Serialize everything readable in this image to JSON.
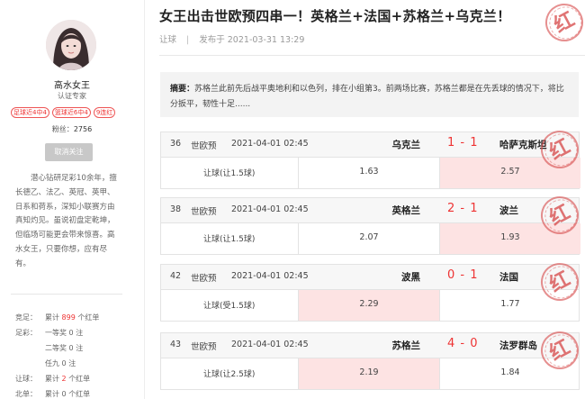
{
  "sidebar": {
    "name": "高水女王",
    "role": "认证专家",
    "tags": [
      "足球近4中4",
      "篮球近6中4",
      "9连红"
    ],
    "fans_label": "粉丝：",
    "fans_count": "2756",
    "unfollow_label": "取消关注",
    "bio": "潜心钻研足彩10余年，擅长德乙、法乙、英冠、英甲、日系和荷系，深知小联赛方由真知灼见。虽说初盘定乾坤，但临场可能更会带来惊喜。高水女王，只要你想，应有尽有。",
    "stats": [
      {
        "label": "竞足：",
        "prefix": "累计",
        "value": "899",
        "suffix": "个红单"
      },
      {
        "label": "足彩：",
        "prefix": "一等奖",
        "value": "0",
        "suffix": "注"
      },
      {
        "label": "",
        "prefix": "二等奖",
        "value": "0",
        "suffix": "注"
      },
      {
        "label": "",
        "prefix": "任九",
        "value": "0",
        "suffix": "注"
      },
      {
        "label": "让球：",
        "prefix": "累计",
        "value": "2",
        "suffix": "个红单"
      },
      {
        "label": "北单：",
        "prefix": "累计",
        "value": "0",
        "suffix": "个红单"
      }
    ]
  },
  "article": {
    "title": "女王出击世欧预四串一！英格兰+法国+苏格兰+乌克兰！",
    "category": "让球",
    "publish_label": "发布于",
    "publish_time": "2021-03-31 13:29",
    "summary_label": "摘要：",
    "summary_text": "苏格兰此前先后战平奥地利和以色列，排在小组第3。前两场比赛，苏格兰都是在先丢球的情况下，将比分扳平，韧性十足......",
    "stamp_char": "红"
  },
  "matches": [
    {
      "num": "36",
      "league": "世欧预",
      "time": "2021-04-01 02:45",
      "home": "乌克兰",
      "score": "1 - 1",
      "away": "哈萨克斯坦",
      "handicap": "让球(让1.5球)",
      "home_odds": "1.63",
      "away_odds": "2.57",
      "picked": "away"
    },
    {
      "num": "38",
      "league": "世欧预",
      "time": "2021-04-01 02:45",
      "home": "英格兰",
      "score": "2 - 1",
      "away": "波兰",
      "handicap": "让球(让1.5球)",
      "home_odds": "2.07",
      "away_odds": "1.93",
      "picked": "away"
    },
    {
      "num": "42",
      "league": "世欧预",
      "time": "2021-04-01 02:45",
      "home": "波黑",
      "score": "0 - 1",
      "away": "法国",
      "handicap": "让球(受1.5球)",
      "home_odds": "2.29",
      "away_odds": "1.77",
      "picked": "home"
    },
    {
      "num": "43",
      "league": "世欧预",
      "time": "2021-04-01 02:45",
      "home": "苏格兰",
      "score": "4 - 0",
      "away": "法罗群岛",
      "handicap": "让球(让2.5球)",
      "home_odds": "2.19",
      "away_odds": "1.84",
      "picked": "home"
    }
  ],
  "colors": {
    "accent_red": "#e33333",
    "picked_bg": "#fde3e3"
  }
}
